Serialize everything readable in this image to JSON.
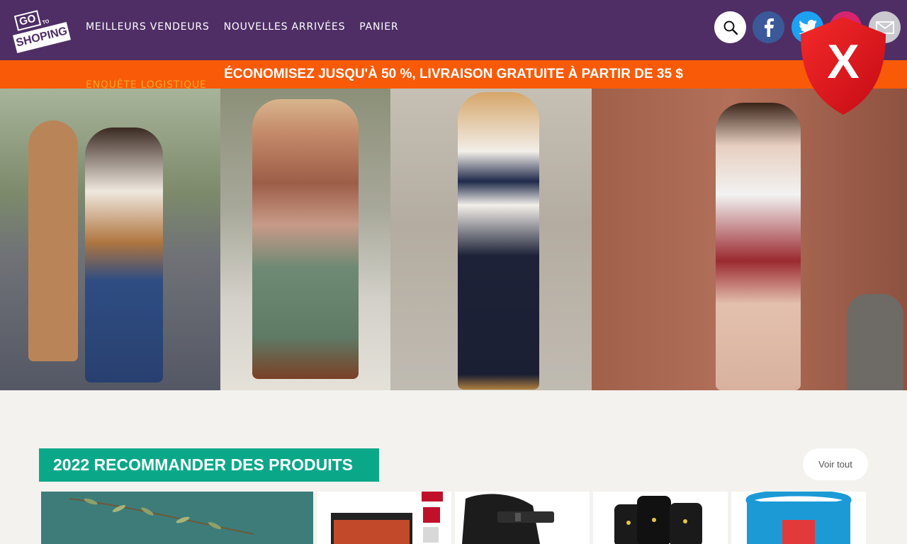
{
  "header": {
    "logo": {
      "line1": "GO",
      "line2": "TO",
      "line3": "SHOPING"
    },
    "nav": [
      "MEILLEURS VENDEURS",
      "NOUVELLES ARRIVÉES",
      "PANIER"
    ],
    "nav_overflow": "ENQUÊTE LOGISTIQUE",
    "icons": [
      "search-icon",
      "facebook-icon",
      "twitter-icon",
      "instagram-icon",
      "mail-icon"
    ]
  },
  "banner": {
    "text": "ÉCONOMISEZ JUSQU'À 50 %, LIVRAISON GRATUITE À PARTIR DE 35 $"
  },
  "overlay": {
    "shield_letter": "X"
  },
  "section": {
    "title": "2022 RECOMMANDER DES PRODUITS",
    "see_all": "Voir tout"
  },
  "colors": {
    "header": "#4f2e66",
    "banner": "#f85a08",
    "accent": "#0aa889",
    "shield": "#e0141e"
  }
}
